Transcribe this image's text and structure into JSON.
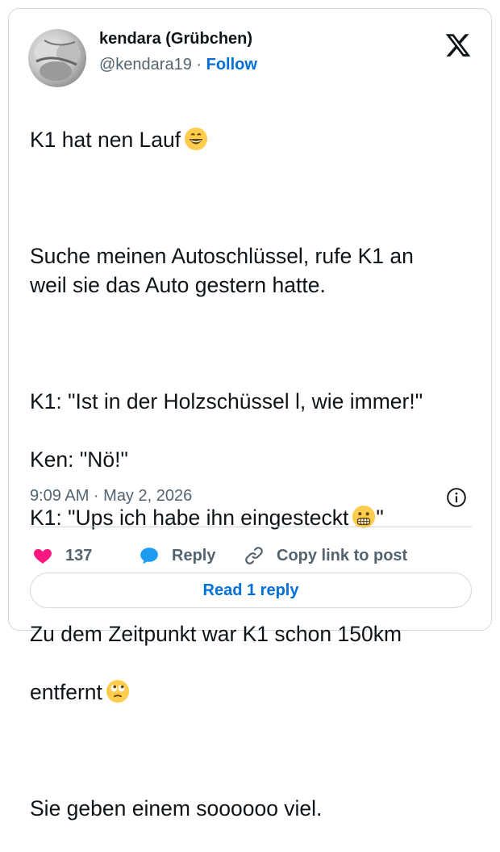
{
  "author": {
    "display_name": "kendara (Grübchen)",
    "handle": "@kendara19",
    "separator": "·",
    "follow_label": "Follow"
  },
  "tweet": {
    "line1": "K1 hat nen Lauf",
    "para2": "Suche meinen Autoschlüssel, rufe K1 an\nweil sie das Auto gestern hatte.",
    "line3a": "K1: \"Ist in der Holzschüssel l, wie immer!\"",
    "line3b": "Ken: \"Nö!\"",
    "line3c_start": "K1: \"Ups ich habe ihn eingesteckt",
    "line3c_end": "\"",
    "para4a": "Zu dem Zeitpunkt war K1 schon 150km",
    "para4b": "entfernt",
    "para5": "Sie geben einem soooooo viel.",
    "emojis": [
      "grinning-face-emoji",
      "grimacing-face-emoji",
      "face-with-rolling-eyes-emoji"
    ]
  },
  "timestamp": "9:09 AM · May 2, 2026",
  "actions": {
    "like_count": "137",
    "reply_label": "Reply",
    "copy_label": "Copy link to post"
  },
  "read_replies_label": "Read 1 reply",
  "colors": {
    "link_blue": "#006fd6",
    "like_pink": "#f91880",
    "reply_blue": "#1d9bf0",
    "muted": "#536471",
    "border": "#cfd9de"
  },
  "icons": [
    "x-logo-icon",
    "info-icon",
    "heart-icon",
    "reply-bubble-icon",
    "link-icon"
  ]
}
